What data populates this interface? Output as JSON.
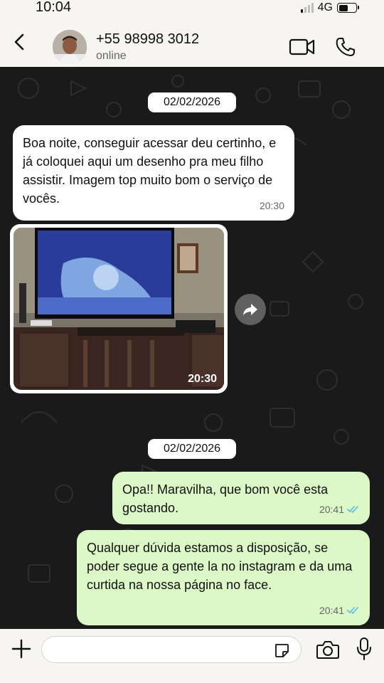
{
  "status_bar": {
    "time": "10:04",
    "network": "4G",
    "battery_level": 0.55
  },
  "header": {
    "contact_name": "+55 98998 3012",
    "contact_status": "online",
    "icons": [
      "back-icon",
      "avatar",
      "video-call-icon",
      "phone-icon"
    ]
  },
  "chat": {
    "date_chip_1": "02/02/2026",
    "date_chip_2": "02/02/2026",
    "messages": [
      {
        "direction": "incoming",
        "text": "Boa noite, conseguir acessar deu certinho, e já coloquei aqui um desenho pra meu filho assistir. Imagem top muito bom o serviço de vocês.",
        "time": "20:30"
      },
      {
        "direction": "incoming",
        "type": "image",
        "time": "20:30"
      },
      {
        "direction": "outgoing",
        "text": "Opa!! Maravilha, que bom você esta gostando.",
        "time": "20:41",
        "status": "read"
      },
      {
        "direction": "outgoing",
        "text": "Qualquer dúvida estamos a disposição, se poder segue a gente la no instagram e da uma curtida na nossa página no face.",
        "time": "20:41",
        "status": "read"
      }
    ]
  },
  "input_bar": {
    "value": "",
    "placeholder": ""
  },
  "colors": {
    "chat_background": "#1a1a1a",
    "incoming_bubble": "#ffffff",
    "outgoing_bubble": "#dcf8c6",
    "read_ticks": "#53bdeb"
  }
}
